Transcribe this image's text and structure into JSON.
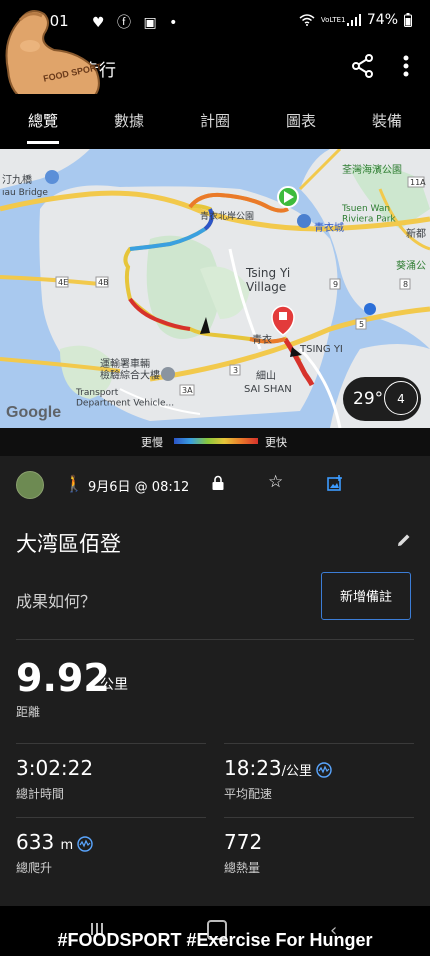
{
  "status_bar": {
    "time": "3:01",
    "battery": "74%",
    "network": "VoLTE1"
  },
  "header": {
    "title": "步行",
    "logo_text": "FOOD SPORT"
  },
  "tabs": [
    {
      "label": "總覽",
      "active": true
    },
    {
      "label": "數據"
    },
    {
      "label": "計圈"
    },
    {
      "label": "圖表"
    },
    {
      "label": "裝備"
    }
  ],
  "map": {
    "labels": {
      "tsing_yi_village": "Tsing Yi\nVillage",
      "tsing_yi_cn": "青衣",
      "tsing_yi_en": "TSING YI",
      "sai_shan_cn": "細山",
      "sai_shan_en": "SAI SHAN",
      "transport_cn": "運輸署車輛\n檢驗綜合大樓",
      "transport_en": "Transport\nDepartment Vehicle...",
      "tsuen_wan_park_cn": "荃灣海濱公園",
      "tsuen_wan_park_en": "Tsuen Wan\nRiviera Park",
      "tsing_yi_park": "青衣北岸公園",
      "tsing_yi_city": "青衣城",
      "sun_ka": "新都",
      "kwai_chung": "葵涌公",
      "river_bridge_cn": "汀九橋",
      "river_bridge_en": "ıau Bridge",
      "google": "Google",
      "route_11a": "11A",
      "route_4e": "4E",
      "route_4b": "4B",
      "route_3": "3",
      "route_3a": "3A",
      "route_5": "5",
      "route_8": "8",
      "route_9": "9"
    },
    "temperature": "29°",
    "wind": "4"
  },
  "legend": {
    "slow": "更慢",
    "fast": "更快"
  },
  "activity": {
    "date": "9月6日 @ 08:12",
    "title": "大湾區佰登",
    "question": "成果如何？",
    "add_note": "新增備註",
    "distance": {
      "value": "9.92",
      "unit": "公里",
      "label": "距離"
    },
    "total_time": {
      "value": "3:02:22",
      "label": "總計時間"
    },
    "avg_pace": {
      "value": "18:23",
      "unit": "/公里",
      "label": "平均配速"
    },
    "total_ascent": {
      "value": "633",
      "unit": "m",
      "label": "總爬升"
    },
    "calories": {
      "value": "772",
      "label": "總熱量"
    }
  },
  "caption": "#FOODSPORT #Exercise For Hunger",
  "colors": {
    "accent": "#3c7dd6",
    "background": "#1e1e1e",
    "route_fast": "#d6322b",
    "route_slow": "#2c55c8"
  }
}
